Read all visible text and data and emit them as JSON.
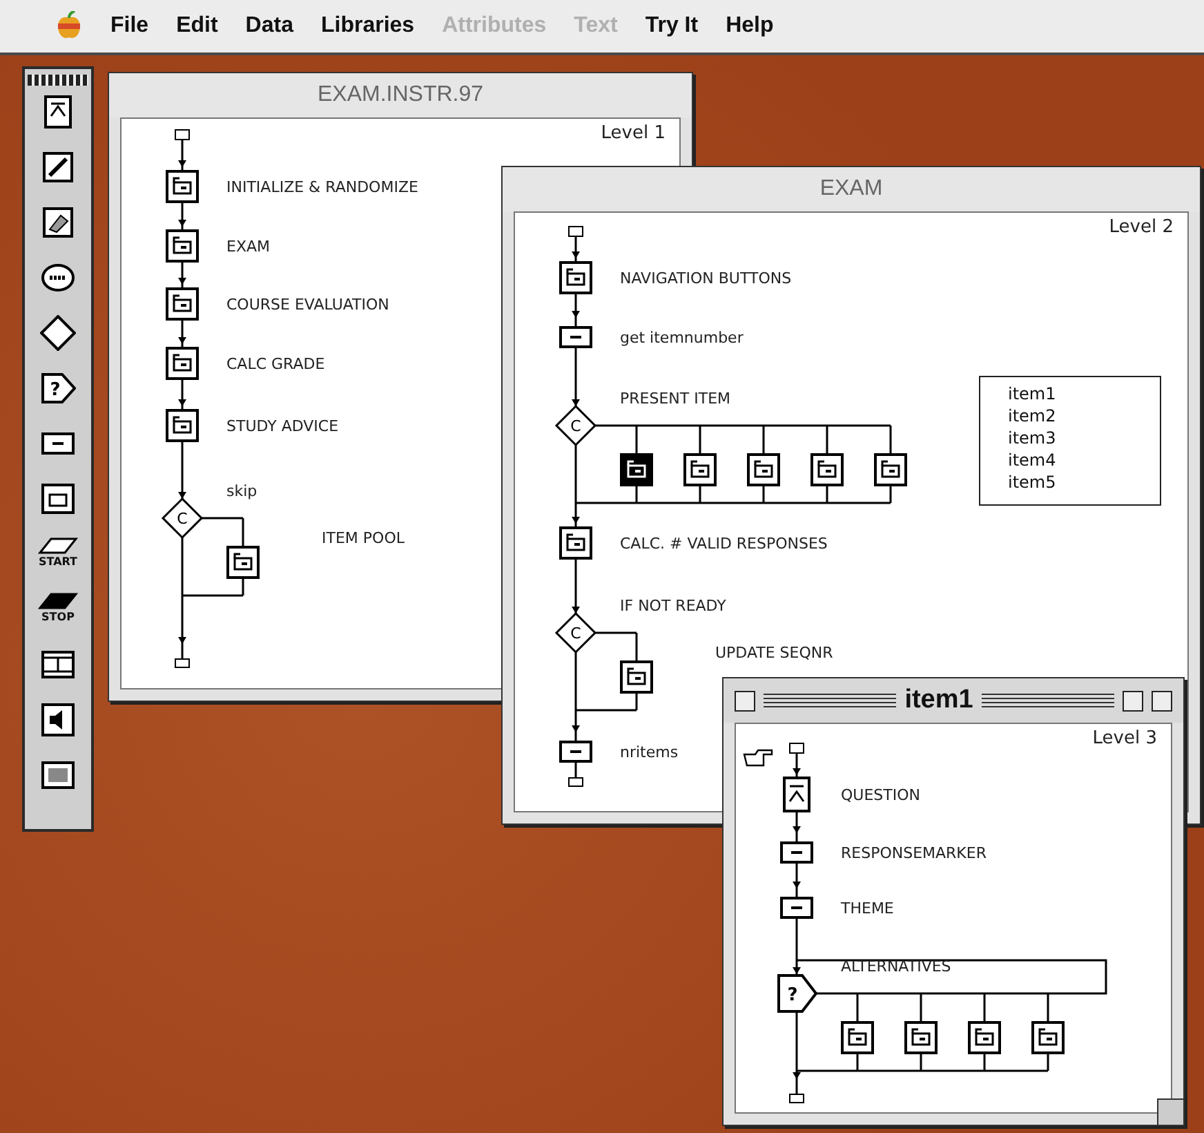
{
  "menu_bar": {
    "items": [
      {
        "label": "File",
        "disabled": false
      },
      {
        "label": "Edit",
        "disabled": false
      },
      {
        "label": "Data",
        "disabled": false
      },
      {
        "label": "Libraries",
        "disabled": false
      },
      {
        "label": "Attributes",
        "disabled": true
      },
      {
        "label": "Text",
        "disabled": true
      },
      {
        "label": "Try It",
        "disabled": false
      },
      {
        "label": "Help",
        "disabled": false
      }
    ]
  },
  "palette": {
    "tools": [
      {
        "kind": "display"
      },
      {
        "kind": "animation"
      },
      {
        "kind": "erase"
      },
      {
        "kind": "wait"
      },
      {
        "kind": "decision"
      },
      {
        "kind": "interaction",
        "symbol": "?"
      },
      {
        "kind": "calculation"
      },
      {
        "kind": "map"
      },
      {
        "kind": "start",
        "label": "START"
      },
      {
        "kind": "stop",
        "label": "STOP"
      },
      {
        "kind": "movie"
      },
      {
        "kind": "sound"
      },
      {
        "kind": "video"
      }
    ]
  },
  "windows": [
    {
      "title": "EXAM.INSTR.97",
      "active": false,
      "level": "Level 1",
      "paste_pointer": false,
      "nodes": [
        {
          "kind": "start"
        },
        {
          "kind": "map",
          "label": "INITIALIZE & RANDOMIZE"
        },
        {
          "kind": "map",
          "label": "EXAM"
        },
        {
          "kind": "map",
          "label": "COURSE EVALUATION"
        },
        {
          "kind": "map",
          "label": "CALC GRADE"
        },
        {
          "kind": "map",
          "label": "STUDY ADVICE"
        },
        {
          "kind": "decision",
          "symbol": "C",
          "label": "skip",
          "children": [
            {
              "kind": "map",
              "label": "ITEM POOL",
              "selected": false
            }
          ]
        },
        {
          "kind": "end"
        }
      ]
    },
    {
      "title": "EXAM",
      "active": false,
      "level": "Level 2",
      "paste_pointer": false,
      "list_box": [
        "item1",
        "item2",
        "item3",
        "item4",
        "item5"
      ],
      "nodes": [
        {
          "kind": "start"
        },
        {
          "kind": "map",
          "label": "NAVIGATION BUTTONS"
        },
        {
          "kind": "calculation",
          "label": "get itemnumber"
        },
        {
          "kind": "decision",
          "symbol": "C",
          "label": "PRESENT ITEM",
          "children": [
            {
              "kind": "map",
              "selected": true
            },
            {
              "kind": "map",
              "selected": false
            },
            {
              "kind": "map",
              "selected": false
            },
            {
              "kind": "map",
              "selected": false
            },
            {
              "kind": "map",
              "selected": false
            }
          ]
        },
        {
          "kind": "map",
          "label": "CALC. # VALID RESPONSES"
        },
        {
          "kind": "decision",
          "symbol": "C",
          "label": "IF NOT READY",
          "children": [
            {
              "kind": "map",
              "label": "UPDATE SEQNR",
              "selected": false
            }
          ]
        },
        {
          "kind": "calculation",
          "label": "nritems"
        },
        {
          "kind": "end"
        }
      ]
    },
    {
      "title": "item1",
      "active": true,
      "level": "Level 3",
      "paste_pointer": true,
      "nodes": [
        {
          "kind": "start"
        },
        {
          "kind": "display",
          "label": "QUESTION"
        },
        {
          "kind": "calculation",
          "label": "RESPONSEMARKER"
        },
        {
          "kind": "calculation",
          "label": "THEME"
        },
        {
          "kind": "interaction",
          "symbol": "?",
          "label": "ALTERNATIVES",
          "children": [
            {
              "kind": "map",
              "selected": false
            },
            {
              "kind": "map",
              "selected": false
            },
            {
              "kind": "map",
              "selected": false
            },
            {
              "kind": "map",
              "selected": false
            }
          ]
        },
        {
          "kind": "end"
        }
      ]
    }
  ]
}
